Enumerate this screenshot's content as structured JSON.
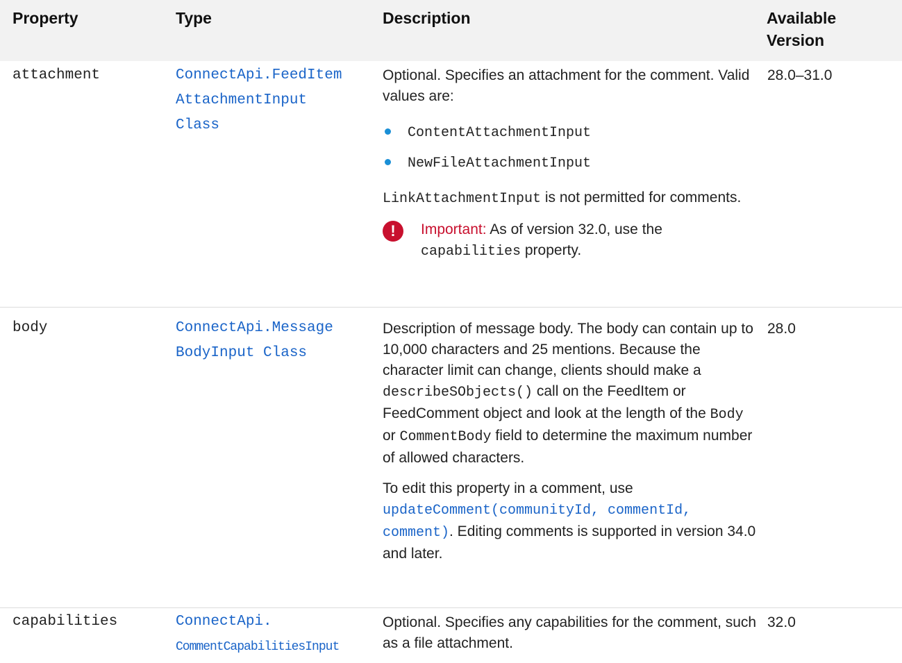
{
  "headers": {
    "property": "Property",
    "type": "Type",
    "description": "Description",
    "version_line1": "Available",
    "version_line2": "Version"
  },
  "rows": [
    {
      "property": "attachment",
      "type_lines": [
        "ConnectApi.FeedItem",
        "AttachmentInput",
        "Class"
      ],
      "desc_p1": "Optional. Specifies an attachment for the comment. Valid values are:",
      "bullets": [
        "ContentAttachmentInput",
        "NewFileAttachmentInput"
      ],
      "desc_p2_code": "LinkAttachmentInput",
      "desc_p2_text": " is not permitted for comments.",
      "important_label": "Important:",
      "important_text": "As of version 32.0, use the",
      "important_code": "capabilities",
      "important_tail": " property.",
      "version": "28.0–31.0"
    },
    {
      "property": "body",
      "type_lines": [
        "ConnectApi.Message",
        "BodyInput Class"
      ],
      "desc_a": "Description of message body. The body can contain up to 10,000 characters and 25 mentions. Because the character limit can change, clients should make a ",
      "desc_code1": "describeSObjects()",
      "desc_b": " call on the FeedItem or FeedComment object and look at the length of the ",
      "desc_code2": "Body",
      "desc_c": " or ",
      "desc_code3": "CommentBody",
      "desc_d": " field to determine the maximum number of allowed characters.",
      "edit_text": "To edit this property in a comment, use",
      "edit_link": "updateComment(communityId, commentId, comment)",
      "edit_tail": ". Editing comments is supported in version 34.0 and later.",
      "version": "28.0"
    },
    {
      "property": "capabilities",
      "type_lines": [
        "ConnectApi.",
        "CommentCapabilitiesInput"
      ],
      "desc": "Optional. Specifies any capabilities for the comment, such as a file attachment.",
      "version": "32.0"
    }
  ]
}
